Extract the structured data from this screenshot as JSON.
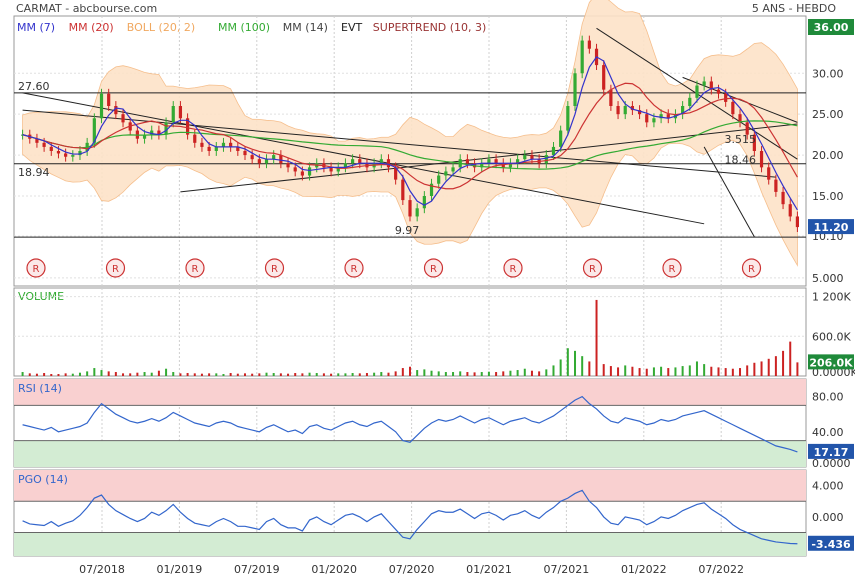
{
  "header": {
    "left": "CARMAT - abcbourse.com",
    "right": "5 ANS - HEBDO"
  },
  "legend": [
    {
      "label": "MM (7)",
      "color": "#3333cc"
    },
    {
      "label": "MM (20)",
      "color": "#cc3333"
    },
    {
      "label": "BOLL (20, 2)",
      "color": "#f0a860"
    },
    {
      "label": "MM (100)",
      "color": "#33aa33"
    },
    {
      "label": "MM (14)",
      "color": "#444444"
    },
    {
      "label": "EVT",
      "color": "#222222"
    },
    {
      "label": "SUPERTREND (10, 3)",
      "color": "#993333"
    }
  ],
  "colors": {
    "up": "#33aa33",
    "down": "#cc2222",
    "boll_fill": "#fde3c8",
    "rsi": "#3366cc",
    "overbought": "#f9d0d0",
    "oversold": "#d3ecd3"
  },
  "chart_data": [
    {
      "type": "line",
      "name": "price",
      "yticks": [
        "36.00",
        "30.00",
        "25.00",
        "20.00",
        "15.00",
        "10.10",
        "5.000"
      ],
      "ylim": [
        4,
        37
      ],
      "x": [
        "07/2018",
        "01/2019",
        "07/2019",
        "01/2020",
        "07/2020",
        "01/2021",
        "07/2021",
        "01/2022",
        "07/2022"
      ],
      "last_price": "11.20",
      "last_price_label_top": "36.00",
      "annotations": [
        "27.60",
        "18.94",
        "9.97",
        "3.515",
        "18.46"
      ],
      "annotation_positions_note": "",
      "horizontal_levels": [
        27.6,
        18.94,
        9.97
      ],
      "events": [
        "R",
        "R",
        "R",
        "R",
        "R",
        "R",
        "R",
        "R",
        "R",
        "R"
      ],
      "close": [
        22.5,
        22.0,
        21.5,
        21.0,
        20.5,
        20.2,
        19.8,
        20.0,
        20.5,
        21.5,
        24.5,
        27.5,
        26.0,
        25.0,
        24.0,
        23.0,
        22.0,
        22.5,
        23.0,
        22.5,
        24.0,
        26.0,
        24.5,
        22.5,
        21.5,
        21.0,
        20.5,
        21.0,
        21.5,
        21.0,
        20.5,
        20.0,
        19.5,
        19.0,
        19.5,
        20.0,
        19.0,
        18.5,
        18.0,
        17.5,
        18.5,
        19.0,
        18.5,
        18.0,
        18.5,
        19.0,
        19.5,
        19.0,
        18.5,
        19.0,
        19.5,
        18.5,
        17.0,
        14.5,
        12.5,
        13.5,
        15.0,
        16.5,
        17.5,
        18.0,
        18.5,
        19.5,
        19.0,
        18.5,
        19.0,
        19.5,
        19.0,
        18.5,
        19.0,
        19.5,
        20.0,
        19.5,
        19.0,
        20.0,
        21.0,
        23.0,
        26.0,
        30.0,
        34.0,
        33.0,
        31.0,
        28.0,
        26.0,
        25.0,
        26.0,
        25.5,
        25.0,
        24.0,
        24.5,
        25.0,
        24.5,
        25.0,
        26.0,
        27.0,
        28.5,
        29.0,
        28.0,
        27.5,
        26.5,
        25.0,
        24.0,
        22.5,
        20.5,
        18.5,
        17.0,
        15.5,
        14.0,
        12.5,
        11.2
      ]
    },
    {
      "type": "bar",
      "name": "volume",
      "yticks": [
        "1 200K",
        "600.0K",
        "0.0000K"
      ],
      "ylim": [
        0,
        1300
      ],
      "last_value": "206.0K",
      "values": [
        60,
        40,
        35,
        45,
        30,
        30,
        40,
        35,
        50,
        70,
        120,
        90,
        70,
        60,
        40,
        40,
        50,
        60,
        50,
        80,
        110,
        60,
        40,
        45,
        40,
        35,
        40,
        40,
        30,
        45,
        35,
        40,
        35,
        40,
        50,
        45,
        40,
        35,
        45,
        40,
        50,
        45,
        40,
        35,
        40,
        40,
        45,
        40,
        45,
        50,
        60,
        50,
        70,
        120,
        140,
        90,
        100,
        80,
        70,
        60,
        60,
        70,
        60,
        55,
        60,
        65,
        60,
        70,
        80,
        90,
        110,
        80,
        70,
        100,
        160,
        250,
        420,
        380,
        300,
        220,
        1150,
        180,
        150,
        130,
        160,
        140,
        120,
        110,
        130,
        140,
        120,
        130,
        150,
        160,
        220,
        180,
        140,
        130,
        120,
        110,
        120,
        160,
        200,
        220,
        260,
        300,
        380,
        520,
        206
      ]
    },
    {
      "type": "line",
      "name": "RSI (14)",
      "yticks": [
        "80.00",
        "40.00",
        "0.0000"
      ],
      "ylim": [
        0,
        100
      ],
      "upper_band": 70,
      "lower_band": 30,
      "last_value": "17.17",
      "values": [
        48,
        46,
        44,
        42,
        45,
        40,
        42,
        44,
        46,
        50,
        62,
        72,
        66,
        60,
        56,
        52,
        50,
        52,
        55,
        52,
        56,
        62,
        58,
        54,
        50,
        48,
        46,
        50,
        52,
        50,
        46,
        44,
        42,
        40,
        45,
        48,
        44,
        40,
        42,
        38,
        46,
        48,
        44,
        42,
        46,
        50,
        52,
        48,
        46,
        50,
        52,
        46,
        40,
        30,
        28,
        36,
        44,
        50,
        54,
        52,
        54,
        58,
        54,
        50,
        54,
        56,
        52,
        48,
        52,
        54,
        56,
        52,
        50,
        54,
        58,
        64,
        70,
        76,
        80,
        72,
        66,
        58,
        52,
        50,
        56,
        54,
        52,
        48,
        50,
        54,
        52,
        54,
        58,
        60,
        62,
        64,
        60,
        56,
        52,
        48,
        44,
        40,
        36,
        32,
        28,
        24,
        22,
        20,
        17.17
      ]
    },
    {
      "type": "line",
      "name": "PGO (14)",
      "yticks": [
        "4.000",
        "0.000",
        "-3.436"
      ],
      "ylim": [
        -5,
        6
      ],
      "upper_band": 2,
      "lower_band": -2,
      "last_value": "-3.436",
      "values": [
        -0.5,
        -0.9,
        -1.0,
        -1.1,
        -0.6,
        -1.2,
        -0.8,
        -0.5,
        0.2,
        1.2,
        2.4,
        2.8,
        1.6,
        0.8,
        0.3,
        -0.2,
        -0.6,
        -0.2,
        0.6,
        0.2,
        0.8,
        1.6,
        0.6,
        -0.2,
        -0.8,
        -1.0,
        -1.2,
        -0.6,
        -0.2,
        -0.6,
        -1.2,
        -1.2,
        -1.4,
        -1.6,
        -0.6,
        -0.2,
        -1.0,
        -1.4,
        -1.4,
        -1.8,
        -0.4,
        0.0,
        -0.6,
        -1.0,
        -0.4,
        0.2,
        0.4,
        0.0,
        -0.6,
        0.0,
        0.4,
        -0.6,
        -1.6,
        -2.6,
        -2.8,
        -1.6,
        -0.6,
        0.4,
        0.8,
        0.6,
        0.6,
        1.0,
        0.4,
        -0.2,
        0.4,
        0.6,
        0.2,
        -0.4,
        0.2,
        0.4,
        0.8,
        0.2,
        -0.2,
        0.6,
        1.2,
        2.0,
        2.4,
        3.0,
        3.4,
        2.0,
        1.2,
        0.0,
        -0.8,
        -1.0,
        0.0,
        -0.2,
        -0.4,
        -1.0,
        -0.6,
        0.0,
        -0.2,
        0.2,
        0.8,
        1.2,
        1.6,
        1.8,
        1.0,
        0.4,
        -0.2,
        -1.0,
        -1.6,
        -2.0,
        -2.4,
        -2.8,
        -3.0,
        -3.2,
        -3.3,
        -3.4,
        -3.436
      ]
    }
  ]
}
